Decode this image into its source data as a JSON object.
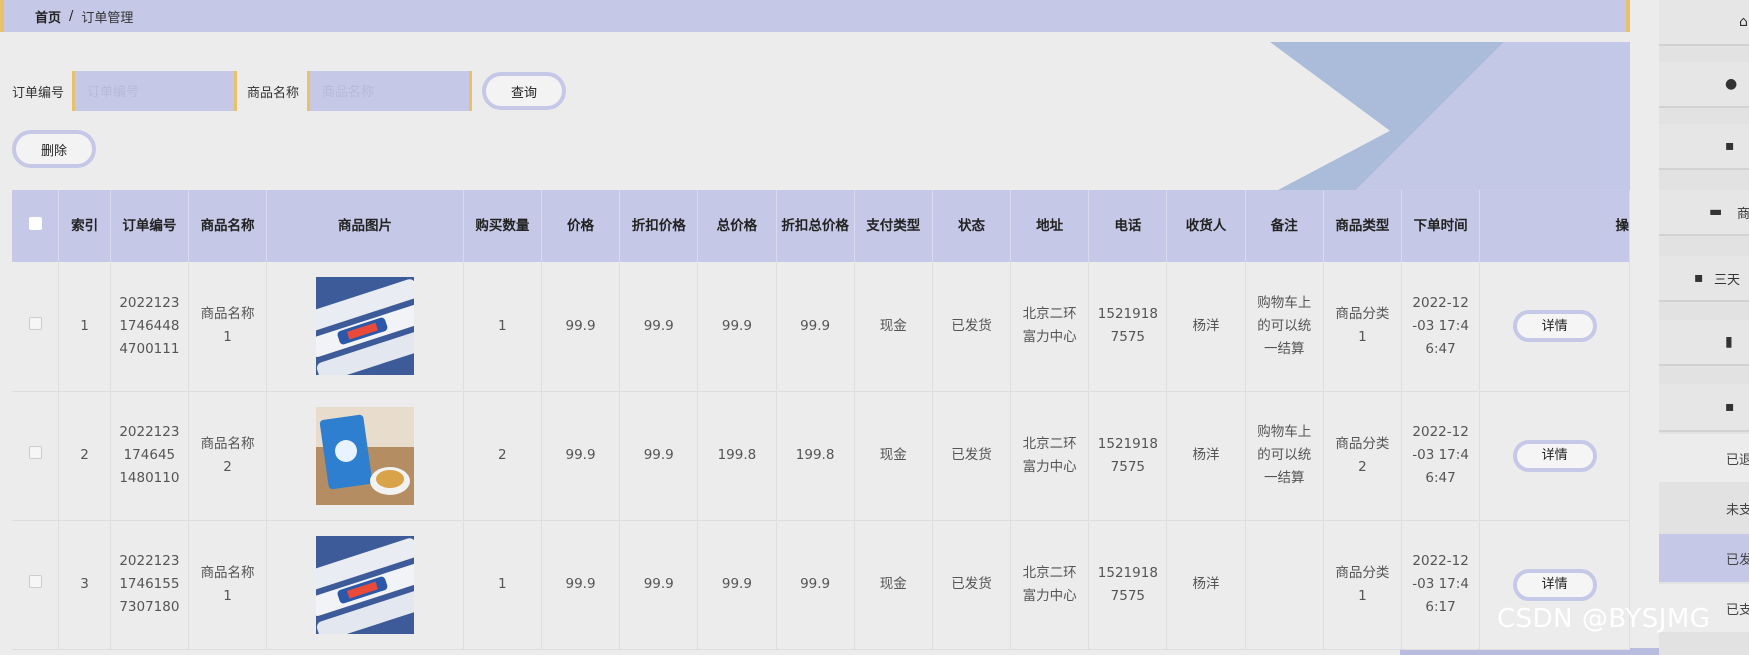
{
  "breadcrumb": {
    "home": "首页",
    "separator": "/",
    "current": "订单管理"
  },
  "search": {
    "order_label": "订单编号",
    "order_placeholder": "订单编号",
    "product_label": "商品名称",
    "product_placeholder": "商品名称",
    "query_button": "查询"
  },
  "delete_button": "删除",
  "table": {
    "headers": [
      "索引",
      "订单编号",
      "商品名称",
      "商品图片",
      "购买数量",
      "价格",
      "折扣价格",
      "总价格",
      "折扣总价格",
      "支付类型",
      "状态",
      "地址",
      "电话",
      "收货人",
      "备注",
      "商品类型",
      "下单时间",
      "操"
    ],
    "rows": [
      {
        "index": "1",
        "order_no": "20221231746448 4700111",
        "name": "商品名称1",
        "qty": "1",
        "price": "99.9",
        "discount_price": "99.9",
        "total": "99.9",
        "discount_total": "99.9",
        "pay": "现金",
        "status": "已发货",
        "address": "北京二环富力中心",
        "phone": "15219187575",
        "receiver": "杨洋",
        "remark": "购物车上的可以统一结算",
        "category": "商品分类1",
        "time": "2022-12-03 17:46:47",
        "action": "详情"
      },
      {
        "index": "2",
        "order_no": "2022123174645 1480110",
        "name": "商品名称2",
        "qty": "2",
        "price": "99.9",
        "discount_price": "99.9",
        "total": "199.8",
        "discount_total": "199.8",
        "pay": "现金",
        "status": "已发货",
        "address": "北京二环富力中心",
        "phone": "15219187575",
        "receiver": "杨洋",
        "remark": "购物车上的可以统一结算",
        "category": "商品分类2",
        "time": "2022-12-03 17:46:47",
        "action": "详情"
      },
      {
        "index": "3",
        "order_no": "20221231746155 7307180",
        "name": "商品名称1",
        "qty": "1",
        "price": "99.9",
        "discount_price": "99.9",
        "total": "99.9",
        "discount_total": "99.9",
        "pay": "现金",
        "status": "已发货",
        "address": "北京二环富力中心",
        "phone": "15219187575",
        "receiver": "杨洋",
        "remark": "",
        "category": "商品分类1",
        "time": "2022-12-03 17:46:17",
        "action": "详情"
      }
    ]
  },
  "sidebar": {
    "items": [
      {
        "icon": "home-icon",
        "label": ""
      },
      {
        "icon": "user-icon",
        "label": ""
      },
      {
        "icon": "grid-icon",
        "label": ""
      },
      {
        "icon": "monitor-icon",
        "label": "商"
      },
      {
        "icon": "grid-icon",
        "label": "三天"
      },
      {
        "icon": "clipboard-icon",
        "label": ""
      },
      {
        "icon": "grid-icon",
        "label": ""
      }
    ],
    "sub_items": [
      "已退",
      "未支",
      "已发",
      "已支"
    ]
  },
  "watermark": "CSDN @BYSJMG",
  "colors": {
    "accent": "#c5c8e6",
    "border_accent": "#e7c26a",
    "background": "#ececec"
  }
}
